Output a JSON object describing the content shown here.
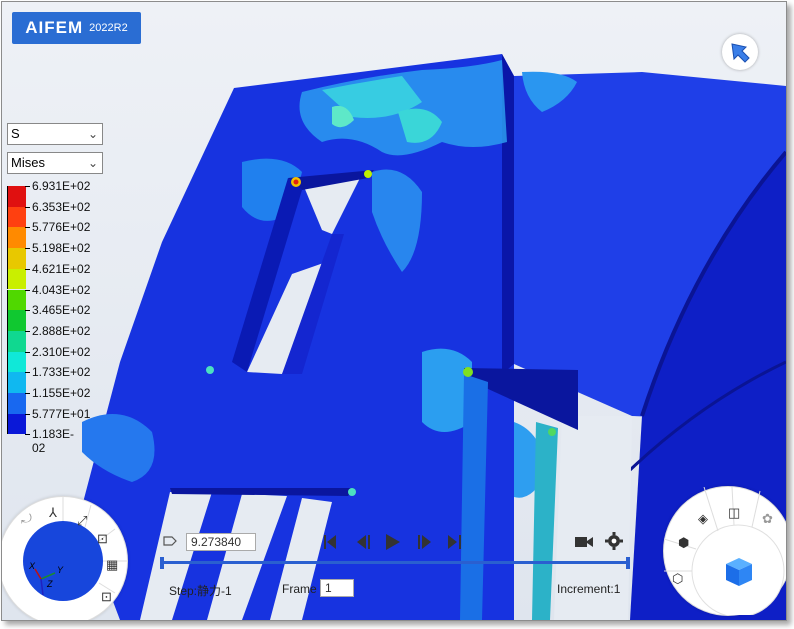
{
  "app": {
    "brand": "AIFEM",
    "version": "2022R2"
  },
  "field_select": {
    "value": "S"
  },
  "component_select": {
    "value": "Mises"
  },
  "legend": {
    "labels": [
      "6.931E+02",
      "6.353E+02",
      "5.776E+02",
      "5.198E+02",
      "4.621E+02",
      "4.043E+02",
      "3.465E+02",
      "2.888E+02",
      "2.310E+02",
      "1.733E+02",
      "1.155E+02",
      "5.777E+01",
      "1.183E-02"
    ],
    "colors": [
      "#e01010",
      "#ff4010",
      "#ff8a00",
      "#e8c800",
      "#c9ef00",
      "#50d800",
      "#10c830",
      "#10d890",
      "#10e8d8",
      "#10b8f0",
      "#1868f0",
      "#0a18d8"
    ]
  },
  "playback": {
    "time_value": "9.273840",
    "step_label": "Step:静力-1",
    "frame_label": "Frame",
    "frame_value": "1",
    "increment_label": "Increment:1",
    "progress": 1.0
  },
  "triad": {
    "x": "X",
    "y": "Y",
    "z": "Z"
  }
}
